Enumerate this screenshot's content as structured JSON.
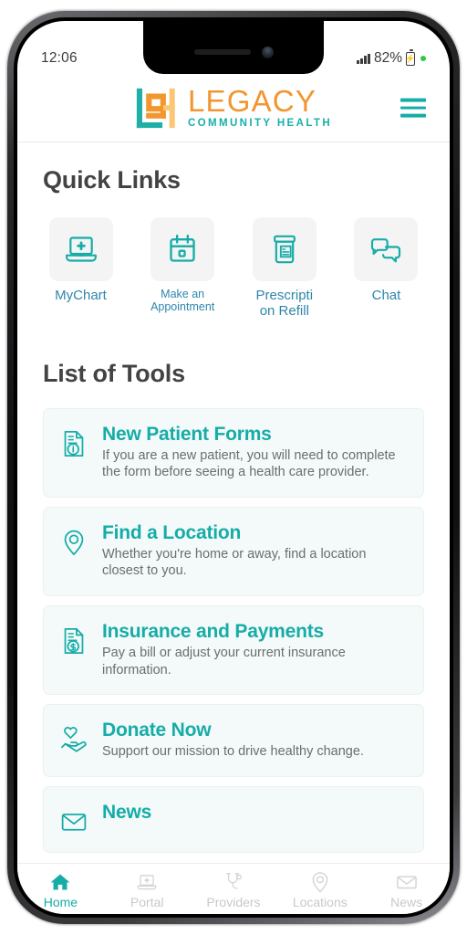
{
  "status_bar": {
    "time": "12:06",
    "battery_percent": "82%",
    "signal_icon": "signal-bars-icon",
    "battery_icon": "battery-charging-icon",
    "indicator_icon": "green-status-dot"
  },
  "header": {
    "brand_name": "LEGACY",
    "brand_tagline": "COMMUNITY HEALTH",
    "logo_icon": "legacy-logo-mark",
    "menu_icon": "hamburger-menu-icon",
    "colors": {
      "brand_orange": "#F2962F",
      "brand_orange_light": "#FBC775",
      "brand_teal": "#18AFA8"
    }
  },
  "quick_links": {
    "title": "Quick Links",
    "items": [
      {
        "label": "MyChart",
        "icon": "laptop-medical-icon",
        "label_size": "lg"
      },
      {
        "label": "Make an Appointment",
        "icon": "calendar-icon",
        "label_size": "sm"
      },
      {
        "label": "Prescripti on Refill",
        "icon": "pill-bottle-icon",
        "label_size": "lg"
      },
      {
        "label": "Chat",
        "icon": "chat-bubbles-icon",
        "label_size": "lg"
      }
    ]
  },
  "tools": {
    "title": "List of Tools",
    "items": [
      {
        "title": "New Patient Forms",
        "description": "If you are a new patient, you will need to complete the form before seeing a health care provider.",
        "icon": "document-info-icon"
      },
      {
        "title": "Find a Location",
        "description": "Whether you're home or away, find a location closest to you.",
        "icon": "map-pin-icon"
      },
      {
        "title": "Insurance and Payments",
        "description": "Pay a bill or adjust your current insurance information.",
        "icon": "document-dollar-icon"
      },
      {
        "title": "Donate Now",
        "description": "Support our mission to drive healthy change.",
        "icon": "hand-heart-icon"
      },
      {
        "title": "News",
        "description": "",
        "icon": "envelope-icon"
      }
    ]
  },
  "bottom_nav": {
    "items": [
      {
        "label": "Home",
        "icon": "home-icon",
        "active": true
      },
      {
        "label": "Portal",
        "icon": "laptop-medical-icon",
        "active": false
      },
      {
        "label": "Providers",
        "icon": "stethoscope-icon",
        "active": false
      },
      {
        "label": "Locations",
        "icon": "map-pin-icon",
        "active": false
      },
      {
        "label": "News",
        "icon": "envelope-icon",
        "active": false
      }
    ],
    "active_color": "#16ACA8",
    "inactive_color": "#c9c9c9"
  }
}
